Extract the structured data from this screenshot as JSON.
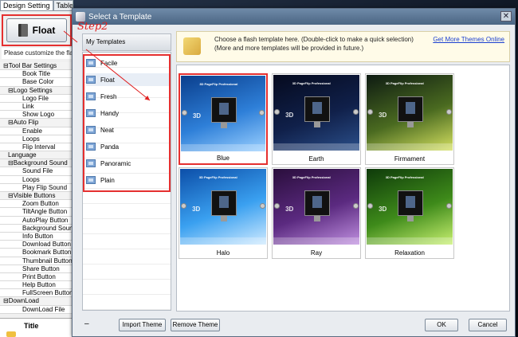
{
  "left_panel": {
    "tabs": [
      {
        "label": "Design Setting",
        "active": true
      },
      {
        "label": "Table of Contents",
        "active": false
      }
    ],
    "float_button_label": "Float",
    "customize_note": "Please customize the flash",
    "tree": [
      {
        "label": "⊟Tool Bar Settings",
        "level": 0
      },
      {
        "label": "Book Title",
        "level": 2
      },
      {
        "label": "Base Color",
        "level": 2
      },
      {
        "label": "⊟Logo Settings",
        "level": 1
      },
      {
        "label": "Logo File",
        "level": 2
      },
      {
        "label": "Link",
        "level": 2
      },
      {
        "label": "Show Logo",
        "level": 2
      },
      {
        "label": "⊟Auto Flip",
        "level": 1
      },
      {
        "label": "Enable",
        "level": 2
      },
      {
        "label": "Loops",
        "level": 2
      },
      {
        "label": "Flip Interval",
        "level": 2
      },
      {
        "label": "Language",
        "level": 1
      },
      {
        "label": "⊟Background Sound",
        "level": 1
      },
      {
        "label": "Sound File",
        "level": 2
      },
      {
        "label": "Loops",
        "level": 2
      },
      {
        "label": "Play Flip Sound",
        "level": 2
      },
      {
        "label": "⊟Visible Buttons",
        "level": 1
      },
      {
        "label": "Zoom Button",
        "level": 2
      },
      {
        "label": "TiltAngle Button",
        "level": 2
      },
      {
        "label": "AutoPlay Button",
        "level": 2
      },
      {
        "label": "Background Soun...",
        "level": 2
      },
      {
        "label": "Info Button",
        "level": 2
      },
      {
        "label": "Download Button",
        "level": 2
      },
      {
        "label": "Bookmark Button",
        "level": 2
      },
      {
        "label": "Thumbnail Button",
        "level": 2
      },
      {
        "label": "Share Button",
        "level": 2
      },
      {
        "label": "Print Button",
        "level": 2
      },
      {
        "label": "Help Button",
        "level": 2
      },
      {
        "label": "FullScreen Button",
        "level": 2
      },
      {
        "label": "⊟DownLoad",
        "level": 0
      },
      {
        "label": "DownLoad File",
        "level": 2
      }
    ],
    "title_label": "Title"
  },
  "dialog": {
    "title": "Select a Template",
    "close_label": "✕",
    "my_templates_header": "My Templates",
    "templates": [
      {
        "label": "Facile"
      },
      {
        "label": "Float"
      },
      {
        "label": "Fresh"
      },
      {
        "label": "Handy"
      },
      {
        "label": "Neat"
      },
      {
        "label": "Panda"
      },
      {
        "label": "Panoramic"
      },
      {
        "label": "Plain"
      }
    ],
    "selected_template": "Float",
    "info_line1": "Choose a flash template here. (Double-click to make a quick selection)",
    "info_line2": "(More and more templates will be provided in future.)",
    "more_link": "Get More Themes Online",
    "thumbnails": [
      {
        "caption": "Blue",
        "header": "3D PageFlip Professional",
        "logo": "3D",
        "selected": true,
        "colors": [
          "#0a3e8c",
          "#2e7fd8",
          "#9bd0ff"
        ]
      },
      {
        "caption": "Earth",
        "header": "3D PageFlip Professional",
        "logo": "3D",
        "selected": false,
        "colors": [
          "#050a1e",
          "#10204a",
          "#2b4f8a"
        ]
      },
      {
        "caption": "Firmament",
        "header": "3D PageFlip Professional",
        "logo": "3D",
        "selected": false,
        "colors": [
          "#0d1a12",
          "#4a6a20",
          "#d4e060"
        ]
      },
      {
        "caption": "Halo",
        "header": "3D PageFlip Professional",
        "logo": "3D",
        "selected": false,
        "colors": [
          "#0c4ea8",
          "#3aa0f0",
          "#cfeaff"
        ]
      },
      {
        "caption": "Ray",
        "header": "3D PageFlip Professional",
        "logo": "3D",
        "selected": false,
        "colors": [
          "#2a0e3c",
          "#5b2a80",
          "#c090e0"
        ]
      },
      {
        "caption": "Relaxation",
        "header": "3D PageFlip Professional",
        "logo": "3D",
        "selected": false,
        "colors": [
          "#0e3a0a",
          "#3e8a1a",
          "#c8f070"
        ]
      }
    ],
    "dash": "–",
    "buttons": {
      "import_theme": "Import Theme",
      "remove_theme": "Remove Theme",
      "ok": "OK",
      "cancel": "Cancel"
    }
  },
  "annotation": {
    "step_label": "Step2",
    "color": "#e02020"
  }
}
